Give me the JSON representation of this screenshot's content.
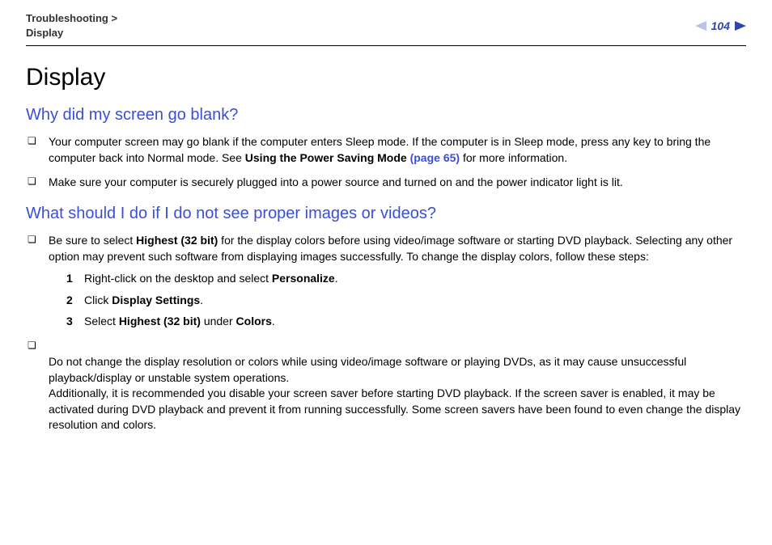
{
  "breadcrumb": {
    "parent": "Troubleshooting",
    "separator": ">",
    "current": "Display"
  },
  "page_number": "104",
  "title": "Display",
  "section1": {
    "heading": "Why did my screen go blank?",
    "item1_a": "Your computer screen may go blank if the computer enters Sleep mode. If the computer is in Sleep mode, press any key to bring the computer back into Normal mode. See ",
    "item1_b_bold": "Using the Power Saving Mode ",
    "item1_c_link": "(page 65)",
    "item1_d": " for more information.",
    "item2": "Make sure your computer is securely plugged into a power source and turned on and the power indicator light is lit."
  },
  "section2": {
    "heading": "What should I do if I do not see proper images or videos?",
    "item1_a": "Be sure to select ",
    "item1_b_bold": "Highest (32 bit)",
    "item1_c": " for the display colors before using video/image software or starting DVD playback. Selecting any other option may prevent such software from displaying images successfully. To change the display colors, follow these steps:",
    "step1_a": "Right-click on the desktop and select ",
    "step1_b_bold": "Personalize",
    "step1_c": ".",
    "step2_a": "Click ",
    "step2_b_bold": "Display Settings",
    "step2_c": ".",
    "step3_a": "Select ",
    "step3_b_bold": "Highest (32 bit)",
    "step3_c": " under ",
    "step3_d_bold": "Colors",
    "step3_e": ".",
    "item2": "Do not change the display resolution or colors while using video/image software or playing DVDs, as it may cause unsuccessful playback/display or unstable system operations.\nAdditionally, it is recommended you disable your screen saver before starting DVD playback. If the screen saver is enabled, it may be activated during DVD playback and prevent it from running successfully. Some screen savers have been found to even change the display resolution and colors."
  }
}
